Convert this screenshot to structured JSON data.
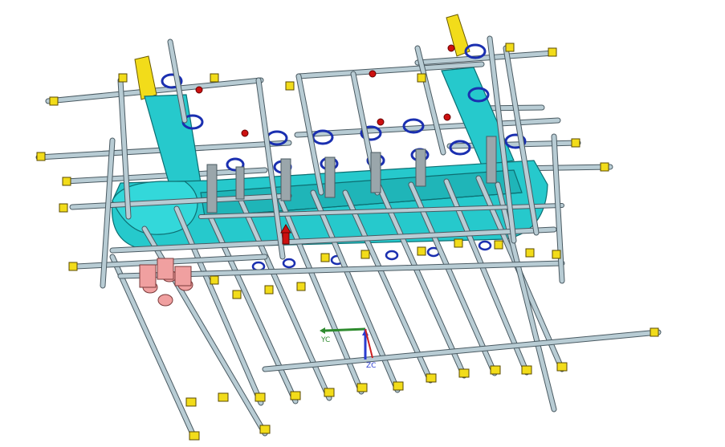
{
  "app": {
    "view": "cad-3d-model-viewport"
  },
  "triad": {
    "x_label": "YC",
    "z_label": "ZC"
  },
  "colors": {
    "background": "#ffffff",
    "rod": "#b8ccd4",
    "rod_outline": "#4a5a62",
    "cyan_part": "#26c9cc",
    "cyan_edge": "#0d6e72",
    "clamp_ring": "#1a2fb0",
    "pin_red": "#cc1010",
    "yellow_cap": "#f2dc1a",
    "pink_cylinder": "#f0a0a0",
    "triad_x": "#2e8b2e",
    "triad_z": "#2a3bd0",
    "triad_y": "#cc2222"
  },
  "icons": [
    "coordinate-triad-icon"
  ]
}
